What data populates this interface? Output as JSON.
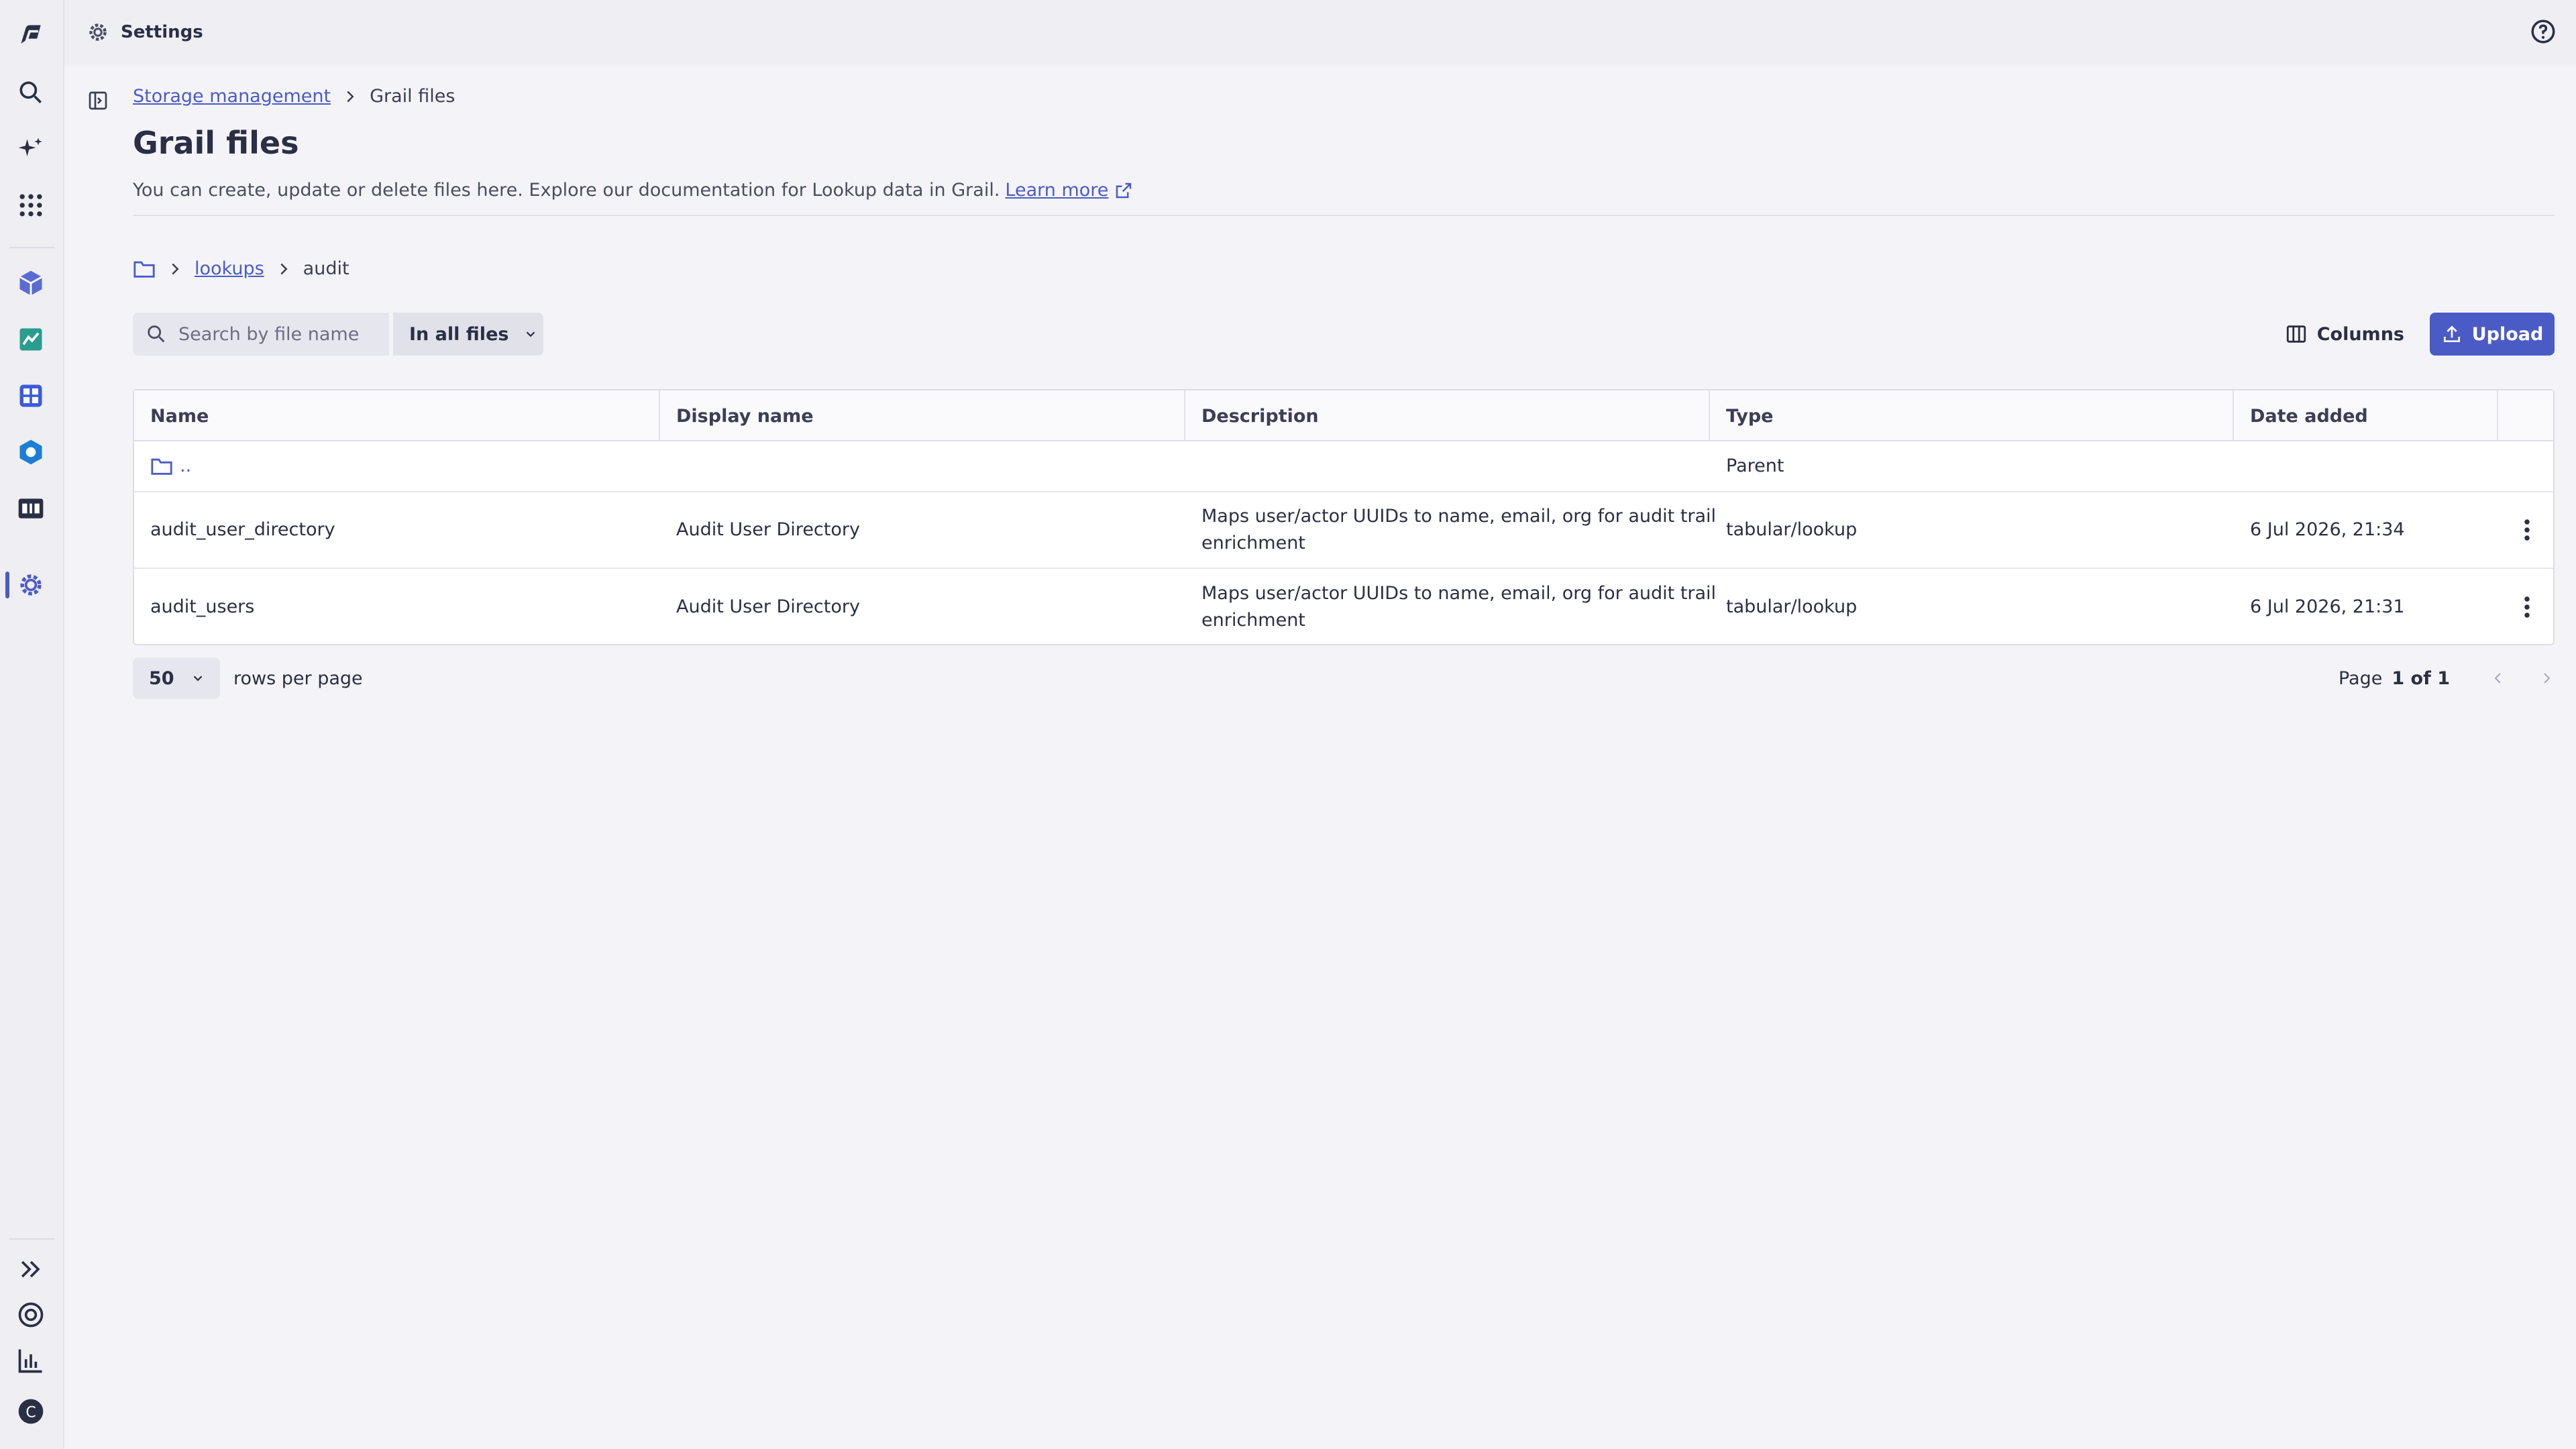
{
  "topbar": {
    "title": "Settings"
  },
  "breadcrumb": {
    "parent": "Storage management",
    "current": "Grail files"
  },
  "page": {
    "title": "Grail files",
    "description": "You can create, update or delete files here. Explore our documentation for Lookup data in Grail.",
    "learn_more": "Learn more"
  },
  "path": {
    "folder": "lookups",
    "current": "audit"
  },
  "toolbar": {
    "search_placeholder": "Search by file name",
    "scope": "In all files",
    "columns": "Columns",
    "upload": "Upload"
  },
  "table": {
    "headers": [
      "Name",
      "Display name",
      "Description",
      "Type",
      "Date added"
    ],
    "parent_row": {
      "name": "..",
      "type": "Parent"
    },
    "rows": [
      {
        "name": "audit_user_directory",
        "display": "Audit User Directory",
        "desc1": "Maps user/actor UUIDs to name, email, org for audit trail",
        "desc2": "enrichment",
        "type": "tabular/lookup",
        "date": "6 Jul 2026, 21:34"
      },
      {
        "name": "audit_users",
        "display": "Audit User Directory",
        "desc1": "Maps user/actor UUIDs to name, email, org for audit trail",
        "desc2": "enrichment",
        "type": "tabular/lookup",
        "date": "6 Jul 2026, 21:31"
      }
    ]
  },
  "pager": {
    "rows_per_page_value": "50",
    "rows_per_page_label": "rows per page",
    "page_label": "Page",
    "page_value": "1 of 1"
  },
  "colors": {
    "accent": "#4b5bc6",
    "rail": "#eeeef3",
    "background": "#f4f4f8"
  }
}
